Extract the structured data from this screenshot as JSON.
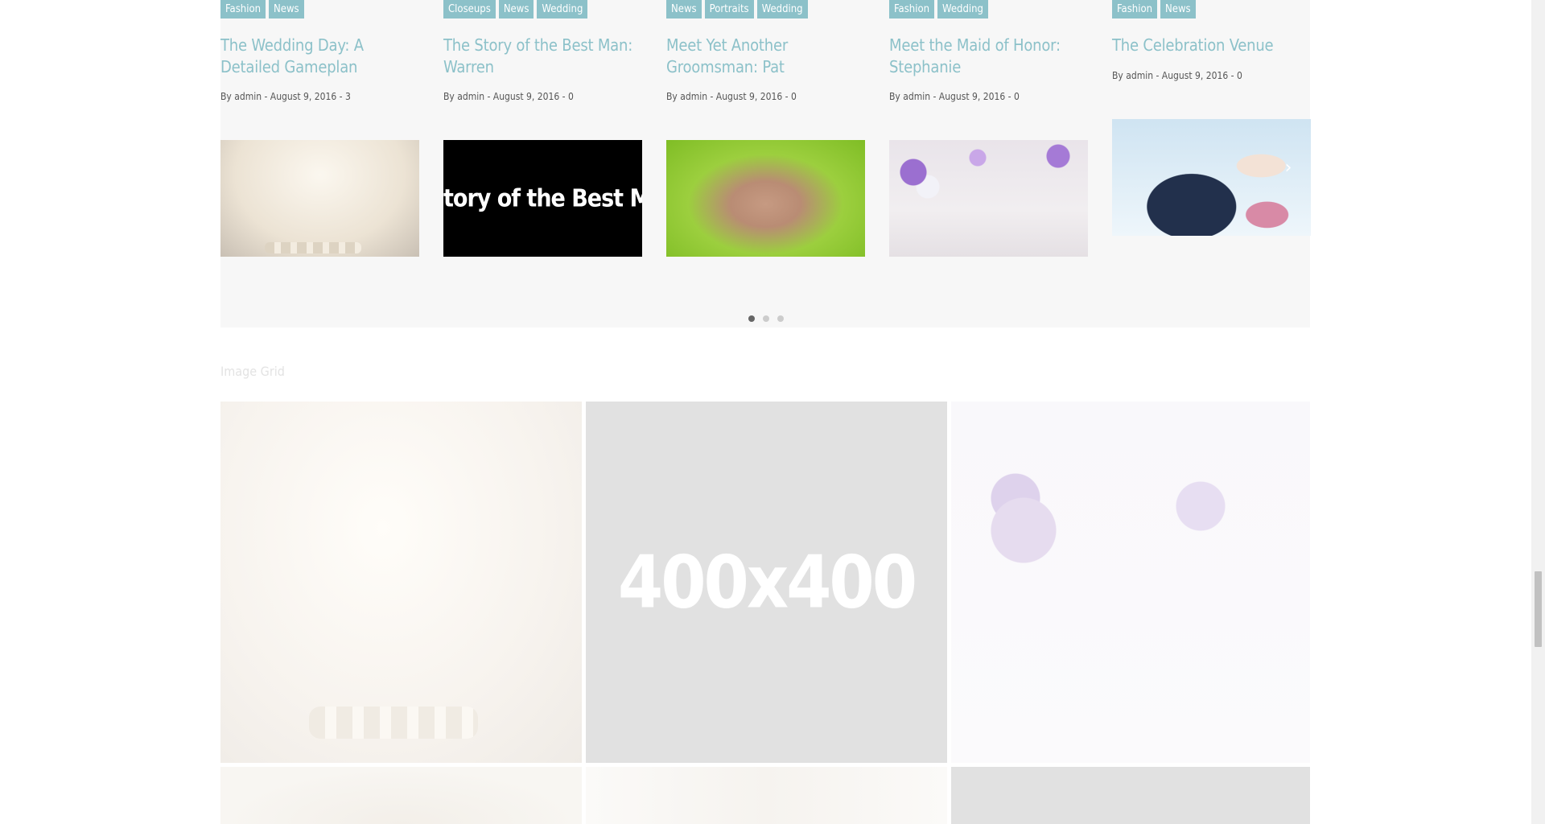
{
  "carousel": {
    "posts": [
      {
        "tags": [
          "Fashion",
          "News"
        ],
        "title": "The Wedding Day: A Detailed Gameplan",
        "meta": "By admin - August 9, 2016 - 3",
        "image": "bride-dress-shoes-photo"
      },
      {
        "tags": [
          "Closeups",
          "News",
          "Wedding"
        ],
        "title": "The Story of the Best Man: Warren",
        "meta": "By admin - August 9, 2016 - 0",
        "image_text": "tory of the Best Man: W"
      },
      {
        "tags": [
          "News",
          "Portraits",
          "Wedding"
        ],
        "title": "Meet Yet Another Groomsman: Pat",
        "meta": "By admin - August 9, 2016 - 0",
        "image": "ring-hands-photo"
      },
      {
        "tags": [
          "Fashion",
          "Wedding"
        ],
        "title": "Meet the Maid of Honor: Stephanie",
        "meta": "By admin - August 9, 2016 - 0",
        "image": "flowers-table-photo"
      },
      {
        "tags": [
          "Fashion",
          "News"
        ],
        "title": "The Celebration Venue",
        "meta": "By admin - August 9, 2016 - 0",
        "image": "couple-kiss-photo"
      }
    ],
    "next_icon": "chevron-right-icon",
    "pagination": {
      "total": 3,
      "active": 1
    }
  },
  "image_grid": {
    "title": "Image Grid",
    "placeholder_text": "400x400"
  },
  "colors": {
    "accent": "#8cc1c9",
    "carousel_bg": "#f7f7f7",
    "placeholder_bg": "#e1e1e1"
  }
}
